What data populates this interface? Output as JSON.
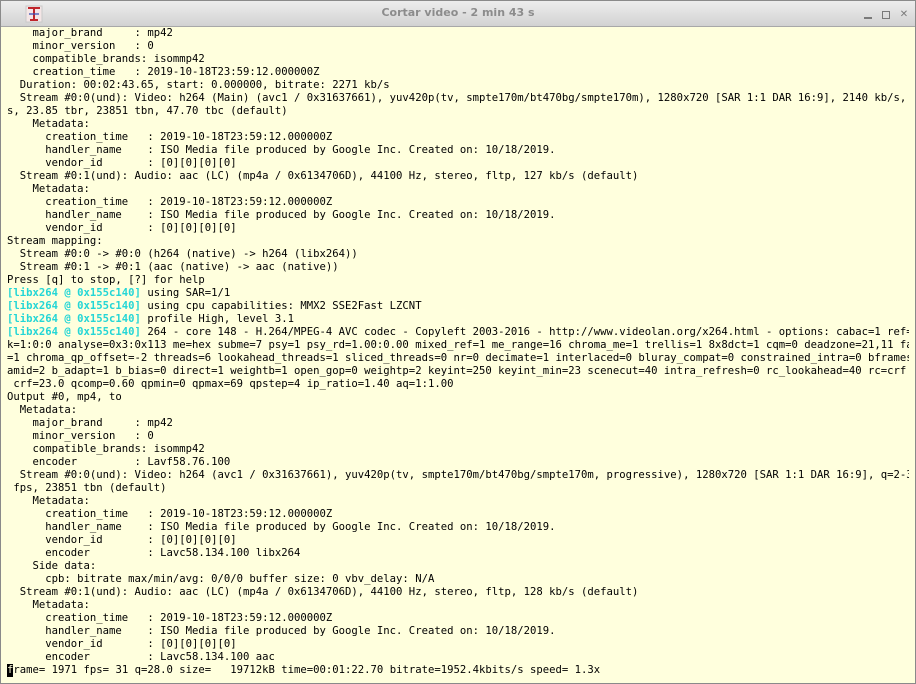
{
  "window": {
    "title": "Cortar video - 2 min 43 s",
    "icon": "red-T-app-icon"
  },
  "terminal": {
    "lines": [
      "    major_brand     : mp42",
      "    minor_version   : 0",
      "    compatible_brands: isommp42",
      "    creation_time   : 2019-10-18T23:59:12.000000Z",
      "  Duration: 00:02:43.65, start: 0.000000, bitrate: 2271 kb/s",
      "  Stream #0:0(und): Video: h264 (Main) (avc1 / 0x31637661), yuv420p(tv, smpte170m/bt470bg/smpte170m), 1280x720 [SAR 1:1 DAR 16:9], 2140 kb/s, 23.85 fp",
      "s, 23.85 tbr, 23851 tbn, 47.70 tbc (default)",
      "    Metadata:",
      "      creation_time   : 2019-10-18T23:59:12.000000Z",
      "      handler_name    : ISO Media file produced by Google Inc. Created on: 10/18/2019.",
      "      vendor_id       : [0][0][0][0]",
      "  Stream #0:1(und): Audio: aac (LC) (mp4a / 0x6134706D), 44100 Hz, stereo, fltp, 127 kb/s (default)",
      "    Metadata:",
      "      creation_time   : 2019-10-18T23:59:12.000000Z",
      "      handler_name    : ISO Media file produced by Google Inc. Created on: 10/18/2019.",
      "      vendor_id       : [0][0][0][0]",
      "Stream mapping:",
      "  Stream #0:0 -> #0:0 (h264 (native) -> h264 (libx264))",
      "  Stream #0:1 -> #0:1 (aac (native) -> aac (native))",
      "Press [q] to stop, [?] for help",
      {
        "prefix": "[libx264 @ 0x155c140]",
        "text": " using SAR=1/1"
      },
      {
        "prefix": "[libx264 @ 0x155c140]",
        "text": " using cpu capabilities: MMX2 SSE2Fast LZCNT"
      },
      {
        "prefix": "[libx264 @ 0x155c140]",
        "text": " profile High, level 3.1"
      },
      {
        "prefix": "[libx264 @ 0x155c140]",
        "text": " 264 - core 148 - H.264/MPEG-4 AVC codec - Copyleft 2003-2016 - http://www.videolan.org/x264.html - options: cabac=1 ref=3 debloc"
      },
      "k=1:0:0 analyse=0x3:0x113 me=hex subme=7 psy=1 psy_rd=1.00:0.00 mixed_ref=1 me_range=16 chroma_me=1 trellis=1 8x8dct=1 cqm=0 deadzone=21,11 fast_pskip",
      "=1 chroma_qp_offset=-2 threads=6 lookahead_threads=1 sliced_threads=0 nr=0 decimate=1 interlaced=0 bluray_compat=0 constrained_intra=0 bframes=3 b_pyr",
      "amid=2 b_adapt=1 b_bias=0 direct=1 weightb=1 open_gop=0 weightp=2 keyint=250 keyint_min=23 scenecut=40 intra_refresh=0 rc_lookahead=40 rc=crf mbtree=1",
      " crf=23.0 qcomp=0.60 qpmin=0 qpmax=69 qpstep=4 ip_ratio=1.40 aq=1:1.00",
      "Output #0, mp4, to",
      "  Metadata:",
      "    major_brand     : mp42",
      "    minor_version   : 0",
      "    compatible_brands: isommp42",
      "    encoder         : Lavf58.76.100",
      "  Stream #0:0(und): Video: h264 (avc1 / 0x31637661), yuv420p(tv, smpte170m/bt470bg/smpte170m, progressive), 1280x720 [SAR 1:1 DAR 16:9], q=2-31, 23.85",
      " fps, 23851 tbn (default)",
      "    Metadata:",
      "      creation_time   : 2019-10-18T23:59:12.000000Z",
      "      handler_name    : ISO Media file produced by Google Inc. Created on: 10/18/2019.",
      "      vendor_id       : [0][0][0][0]",
      "      encoder         : Lavc58.134.100 libx264",
      "    Side data:",
      "      cpb: bitrate max/min/avg: 0/0/0 buffer size: 0 vbv_delay: N/A",
      "  Stream #0:1(und): Audio: aac (LC) (mp4a / 0x6134706D), 44100 Hz, stereo, fltp, 128 kb/s (default)",
      "    Metadata:",
      "      creation_time   : 2019-10-18T23:59:12.000000Z",
      "      handler_name    : ISO Media file produced by Google Inc. Created on: 10/18/2019.",
      "      vendor_id       : [0][0][0][0]",
      "      encoder         : Lavc58.134.100 aac",
      {
        "cursor": "f",
        "text": "rame= 1971 fps= 31 q=28.0 size=   19712kB time=00:01:22.70 bitrate=1952.4kbits/s speed= 1.3x"
      }
    ]
  },
  "colors": {
    "background": "#ffffdd",
    "text": "#000000",
    "libx264_prefix": "#24d6d6"
  }
}
